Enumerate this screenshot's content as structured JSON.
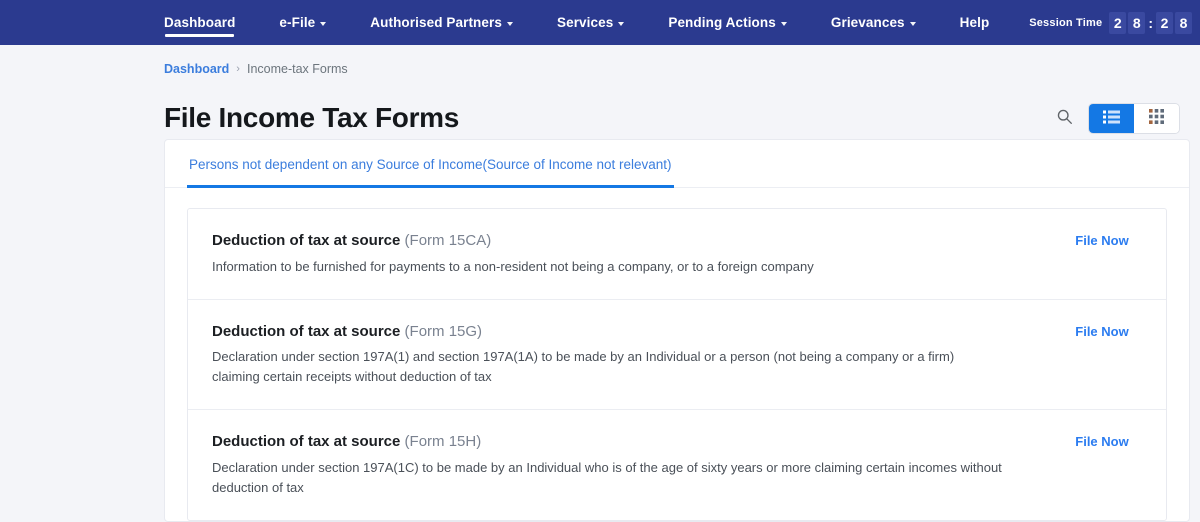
{
  "navbar": {
    "items": [
      {
        "label": "Dashboard",
        "has_caret": false,
        "active": true
      },
      {
        "label": "e-File",
        "has_caret": true,
        "active": false
      },
      {
        "label": "Authorised Partners",
        "has_caret": true,
        "active": false
      },
      {
        "label": "Services",
        "has_caret": true,
        "active": false
      },
      {
        "label": "Pending Actions",
        "has_caret": true,
        "active": false
      },
      {
        "label": "Grievances",
        "has_caret": true,
        "active": false
      },
      {
        "label": "Help",
        "has_caret": false,
        "active": false
      }
    ],
    "session": {
      "label": "Session Time",
      "minutes": [
        "2",
        "8"
      ],
      "separator": ":",
      "seconds": [
        "2",
        "8"
      ]
    },
    "background_color": "#2b3a8f"
  },
  "breadcrumb": {
    "parent": "Dashboard",
    "separator": "›",
    "current": "Income-tax Forms"
  },
  "header": {
    "title": "File Income Tax Forms",
    "search_icon": "search-icon",
    "view_toggle": {
      "list_icon": "list-view-icon",
      "grid_icon": "grid-view-icon",
      "active": "list"
    },
    "accent_color": "#1478e4"
  },
  "tabs": [
    {
      "label": "Persons not dependent on any Source of Income(Source of Income not relevant)",
      "active": true
    }
  ],
  "forms": [
    {
      "title": "Deduction of tax at source",
      "code": "(Form 15CA)",
      "description": "Information to be furnished for payments to a non-resident not being a company, or to a foreign company",
      "action": "File Now"
    },
    {
      "title": "Deduction of tax at source",
      "code": "(Form 15G)",
      "description": "Declaration under section 197A(1) and section 197A(1A) to be made by an Individual or a person (not being a company or a firm) claiming certain receipts without deduction of tax",
      "action": "File Now"
    },
    {
      "title": "Deduction of tax at source",
      "code": "(Form 15H)",
      "description": "Declaration under section 197A(1C) to be made by an Individual who is of the age of sixty years or more claiming certain incomes without deduction of tax",
      "action": "File Now"
    }
  ]
}
